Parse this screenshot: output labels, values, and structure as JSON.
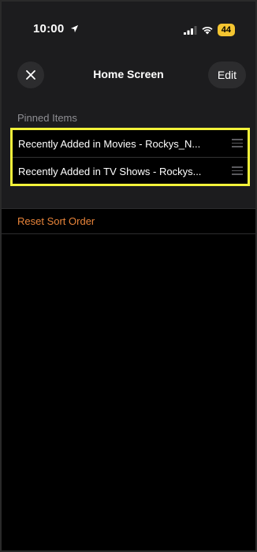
{
  "status_bar": {
    "time": "10:00",
    "battery": "44"
  },
  "nav": {
    "title": "Home Screen",
    "edit_label": "Edit"
  },
  "pinned": {
    "header": "Pinned Items",
    "items": [
      {
        "label": "Recently Added in Movies - Rockys_N..."
      },
      {
        "label": "Recently Added in TV Shows - Rockys..."
      }
    ]
  },
  "actions": {
    "reset_label": "Reset Sort Order"
  },
  "colors": {
    "accent_orange": "#e8843a",
    "highlight_yellow": "#f2f23a",
    "battery_yellow": "#f4c531"
  },
  "icons": [
    "location-arrow-icon",
    "signal-icon",
    "wifi-icon",
    "close-icon",
    "drag-handle-icon"
  ]
}
